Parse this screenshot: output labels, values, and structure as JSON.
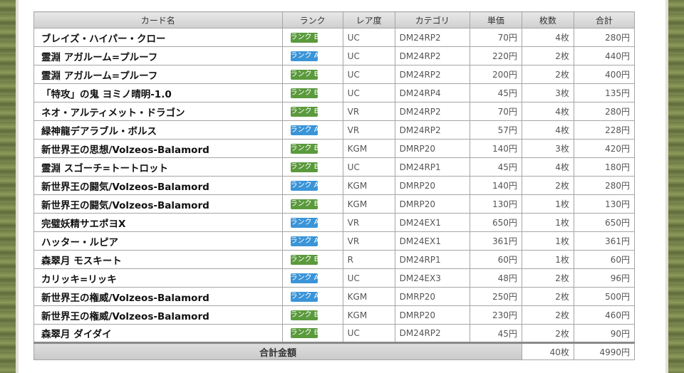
{
  "headers": {
    "name": "カード名",
    "rank": "ランク",
    "rarity": "レア度",
    "category": "カテゴリ",
    "unit_price": "単価",
    "count": "枚数",
    "total": "合計"
  },
  "rows": [
    {
      "name": "ブレイズ・ハイパー・クロー",
      "rank": "ランク B",
      "rank_type": "b",
      "rarity": "UC",
      "category": "DM24RP2",
      "unit_price": "70円",
      "count": "4枚",
      "total": "280円"
    },
    {
      "name": "霊淵 アガルーム=プルーフ",
      "rank": "ランク A",
      "rank_type": "a",
      "rarity": "UC",
      "category": "DM24RP2",
      "unit_price": "220円",
      "count": "2枚",
      "total": "440円"
    },
    {
      "name": "霊淵 アガルーム=プルーフ",
      "rank": "ランク B",
      "rank_type": "b",
      "rarity": "UC",
      "category": "DM24RP2",
      "unit_price": "200円",
      "count": "2枚",
      "total": "400円"
    },
    {
      "name": "「特攻」の鬼 ヨミノ晴明-1.0",
      "rank": "ランク B",
      "rank_type": "b",
      "rarity": "UC",
      "category": "DM24RP4",
      "unit_price": "45円",
      "count": "3枚",
      "total": "135円"
    },
    {
      "name": "ネオ・アルティメット・ドラゴン",
      "rank": "ランク B",
      "rank_type": "b",
      "rarity": "VR",
      "category": "DM24RP2",
      "unit_price": "70円",
      "count": "4枚",
      "total": "280円"
    },
    {
      "name": "緑神龍デアラブル・ボルス",
      "rank": "ランク A",
      "rank_type": "a",
      "rarity": "VR",
      "category": "DM24RP2",
      "unit_price": "57円",
      "count": "4枚",
      "total": "228円"
    },
    {
      "name": "新世界王の思想/Volzeos-Balamord",
      "rank": "ランク B",
      "rank_type": "b",
      "rarity": "KGM",
      "category": "DMRP20",
      "unit_price": "140円",
      "count": "3枚",
      "total": "420円"
    },
    {
      "name": "霊淵 スゴーチ=トートロット",
      "rank": "ランク B",
      "rank_type": "b",
      "rarity": "UC",
      "category": "DM24RP1",
      "unit_price": "45円",
      "count": "4枚",
      "total": "180円"
    },
    {
      "name": "新世界王の闘気/Volzeos-Balamord",
      "rank": "ランク A",
      "rank_type": "a",
      "rarity": "KGM",
      "category": "DMRP20",
      "unit_price": "140円",
      "count": "2枚",
      "total": "280円"
    },
    {
      "name": "新世界王の闘気/Volzeos-Balamord",
      "rank": "ランク B",
      "rank_type": "b",
      "rarity": "KGM",
      "category": "DMRP20",
      "unit_price": "130円",
      "count": "1枚",
      "total": "130円"
    },
    {
      "name": "完璧妖精サエポヨX",
      "rank": "ランク A",
      "rank_type": "a",
      "rarity": "VR",
      "category": "DM24EX1",
      "unit_price": "650円",
      "count": "1枚",
      "total": "650円"
    },
    {
      "name": "ハッター・ルピア",
      "rank": "ランク A",
      "rank_type": "a",
      "rarity": "VR",
      "category": "DM24EX1",
      "unit_price": "361円",
      "count": "1枚",
      "total": "361円"
    },
    {
      "name": "森翠月 モスキート",
      "rank": "ランク B",
      "rank_type": "b",
      "rarity": "R",
      "category": "DM24RP1",
      "unit_price": "60円",
      "count": "1枚",
      "total": "60円"
    },
    {
      "name": "カリッキ=リッキ",
      "rank": "ランク A",
      "rank_type": "a",
      "rarity": "UC",
      "category": "DM24EX3",
      "unit_price": "48円",
      "count": "2枚",
      "total": "96円"
    },
    {
      "name": "新世界王の権威/Volzeos-Balamord",
      "rank": "ランク A",
      "rank_type": "a",
      "rarity": "KGM",
      "category": "DMRP20",
      "unit_price": "250円",
      "count": "2枚",
      "total": "500円"
    },
    {
      "name": "新世界王の権威/Volzeos-Balamord",
      "rank": "ランク B",
      "rank_type": "b",
      "rarity": "KGM",
      "category": "DMRP20",
      "unit_price": "230円",
      "count": "2枚",
      "total": "460円"
    },
    {
      "name": "森翠月 ダイダイ",
      "rank": "ランク B",
      "rank_type": "b",
      "rarity": "UC",
      "category": "DM24RP2",
      "unit_price": "45円",
      "count": "2枚",
      "total": "90円"
    }
  ],
  "summary": {
    "label": "合計金額",
    "count": "40枚",
    "total": "4990円"
  },
  "colors": {
    "rank_a": "#3a94d8",
    "rank_b": "#5a9a3c"
  }
}
